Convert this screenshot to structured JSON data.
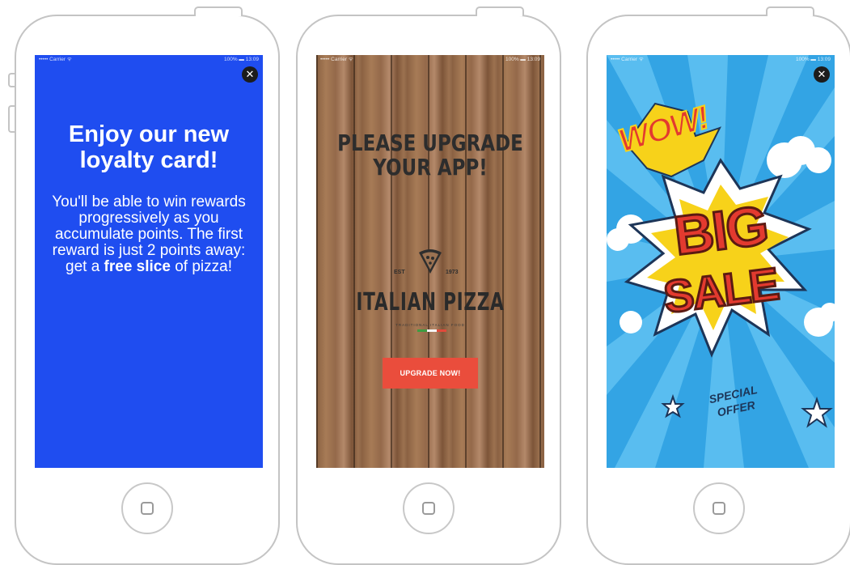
{
  "phones": [
    {
      "status": {
        "carrier": "••••• Carrier ᯤ",
        "battery": "100% ▬ 13:09"
      },
      "close_label": "✕",
      "title": "Enjoy our new loyalty card!",
      "body_before": "You'll be able to win rewards progressively as you accumulate points. The first reward is just 2 points away: get a ",
      "body_bold": "free slice",
      "body_after": " of pizza!",
      "background": "#1f4df0"
    },
    {
      "status": {
        "carrier": "••••• Carrier ᯤ",
        "battery": "100% ▬ 13:09"
      },
      "title_line1": "PLEASE UPGRADE",
      "title_line2": "YOUR APP!",
      "logo_est": "EST",
      "logo_year": "1973",
      "logo_brand": "ITALIAN PIZZA",
      "logo_tagline": "TRADITIONAL ITALIAN FOOD",
      "logo_icon": "pizza-slice-icon",
      "cta_label": "UPGRADE NOW!",
      "flag_colors": [
        "#3e9b41",
        "#ffffff",
        "#e14a3b"
      ],
      "accent": "#ea4d3c"
    },
    {
      "status": {
        "carrier": "••••• Carrier ᯤ",
        "battery": "100% ▬ 13:09"
      },
      "close_label": "✕",
      "wow": "WOW!",
      "big": "BIG",
      "sale": "SALE",
      "special_line1": "SPECIAL",
      "special_line2": "OFFER",
      "background": "#33a4e4"
    }
  ]
}
